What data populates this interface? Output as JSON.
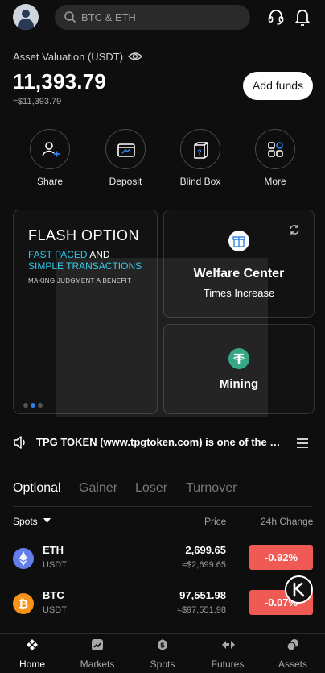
{
  "header": {
    "search_placeholder": "BTC & ETH"
  },
  "assets": {
    "label": "Asset Valuation (USDT)",
    "balance": "11,393.79",
    "balance_fiat": "≈$11,393.79",
    "add_funds": "Add funds"
  },
  "actions": [
    {
      "label": "Share",
      "icon": "share-user-icon"
    },
    {
      "label": "Deposit",
      "icon": "deposit-card-icon"
    },
    {
      "label": "Blind Box",
      "icon": "blind-box-icon"
    },
    {
      "label": "More",
      "icon": "grid-more-icon"
    }
  ],
  "promo": {
    "flash_title": "FLASH OPTION",
    "line1_hl": "FAST PACED",
    "line1_rest": " AND",
    "line2": "SIMPLE TRANSACTIONS",
    "small": "MAKING JUDGMENT A BENEFIT",
    "welfare_title": "Welfare Center",
    "welfare_sub": "Times Increase",
    "mining_title": "Mining"
  },
  "ticker": {
    "text": "TPG TOKEN (www.tpgtoken.com) is one of the world's leading platforms"
  },
  "tabs": [
    "Optional",
    "Gainer",
    "Loser",
    "Turnover"
  ],
  "list_header": {
    "spots": "Spots",
    "price": "Price",
    "change": "24h Change"
  },
  "markets": [
    {
      "symbol": "ETH",
      "quote": "USDT",
      "price": "2,699.65",
      "price_fiat": "≈$2,699.65",
      "change": "-0.92%",
      "color": "#627eea"
    },
    {
      "symbol": "BTC",
      "quote": "USDT",
      "price": "97,551.98",
      "price_fiat": "≈$97,551.98",
      "change": "-0.07%",
      "color": "#f7931a"
    }
  ],
  "nav": [
    "Home",
    "Markets",
    "Spots",
    "Futures",
    "Assets"
  ],
  "colors": {
    "accent": "#2f80ed",
    "down": "#ef5a55",
    "highlight": "#2ac7e8",
    "background": "#0e0e0e"
  }
}
